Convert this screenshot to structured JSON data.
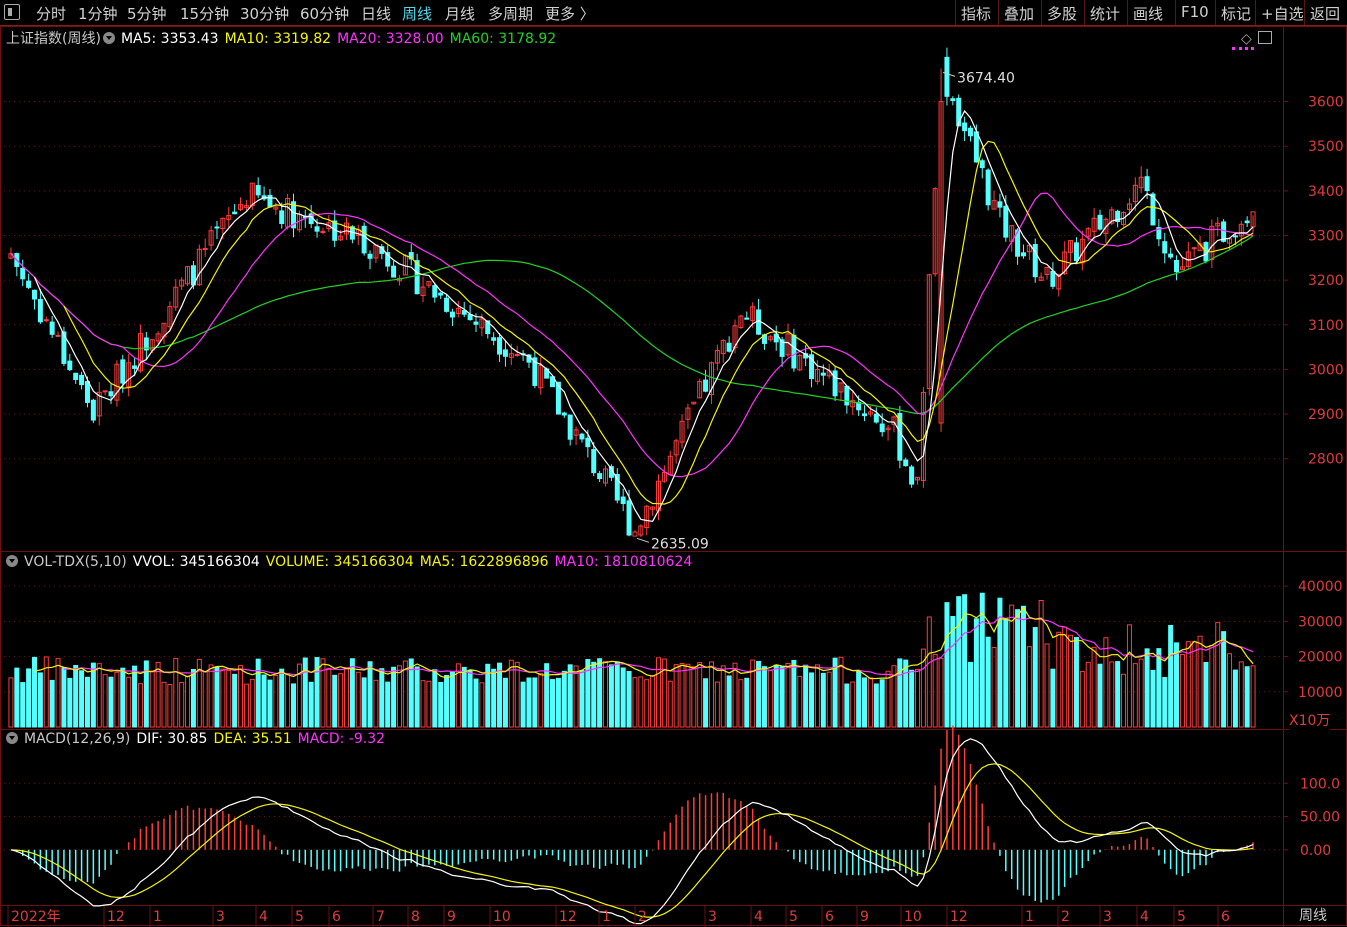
{
  "toolbar": {
    "periods": [
      "分时",
      "1分钟",
      "5分钟",
      "15分钟",
      "30分钟",
      "60分钟",
      "日线",
      "周线",
      "月线",
      "多周期",
      "更多 〉"
    ],
    "active_period": "周线",
    "right_buttons": [
      "指标",
      "叠加",
      "多股",
      "统计",
      "画线",
      "F10",
      "标记",
      "+自选",
      "返回"
    ]
  },
  "main_panel": {
    "title": "上证指数(周线)",
    "ma5_label": "MA5: 3353.43",
    "ma10_label": "MA10: 3319.82",
    "ma20_label": "MA20: 3328.00",
    "ma60_label": "MA60: 3178.92",
    "high_label": "3674.40",
    "low_label": "2635.09",
    "y_ticks": [
      "3600",
      "3500",
      "3400",
      "3300",
      "3200",
      "3100",
      "3000",
      "2900",
      "2800"
    ]
  },
  "volume_panel": {
    "title": "VOL-TDX(5,10)",
    "vvol_label": "VVOL: 345166304",
    "volume_label": "VOLUME: 345166304",
    "ma5_label": "MA5: 1622896896",
    "ma10_label": "MA10: 1810810624",
    "y_ticks": [
      "40000",
      "30000",
      "20000",
      "10000"
    ],
    "unit": "X10万"
  },
  "macd_panel": {
    "title": "MACD(12,26,9)",
    "dif_label": "DIF: 30.85",
    "dea_label": "DEA: 35.51",
    "macd_label": "MACD: -9.32",
    "y_ticks": [
      "100.0",
      "50.00",
      "0.00"
    ]
  },
  "x_axis": {
    "labels": [
      "2022年",
      "12",
      "1",
      "3",
      "4",
      "5",
      "6",
      "7",
      "8",
      "9",
      "10",
      "12",
      "1",
      "2",
      "3",
      "4",
      "5",
      "6",
      "9",
      "10",
      "12",
      "1",
      "2",
      "3",
      "4",
      "5",
      "6"
    ],
    "period_label": "周线"
  },
  "colors": {
    "up": "#ff3c3c",
    "down": "#54ffff",
    "ma5": "#ffffff",
    "ma10": "#f4f400",
    "ma20": "#ff32ff",
    "ma60": "#22d022",
    "grid": "#6e1010",
    "axis_text": "#e23b3b"
  },
  "chart_data": {
    "type": "candlestick",
    "price_key_points": [
      {
        "week": 0,
        "close": 3260
      },
      {
        "week": 14,
        "close": 2905
      },
      {
        "week": 40,
        "close": 3390
      },
      {
        "week": 60,
        "close": 3290
      },
      {
        "week": 88,
        "close": 3020
      },
      {
        "week": 106,
        "close": 2640
      },
      {
        "week": 124,
        "close": 3130
      },
      {
        "week": 150,
        "close": 2860
      },
      {
        "week": 154,
        "close": 2730
      },
      {
        "week": 158,
        "close": 3674
      },
      {
        "week": 168,
        "close": 3330
      },
      {
        "week": 176,
        "close": 3200
      },
      {
        "week": 192,
        "close": 3420
      },
      {
        "week": 198,
        "close": 3220
      },
      {
        "week": 210,
        "close": 3353
      }
    ]
  }
}
